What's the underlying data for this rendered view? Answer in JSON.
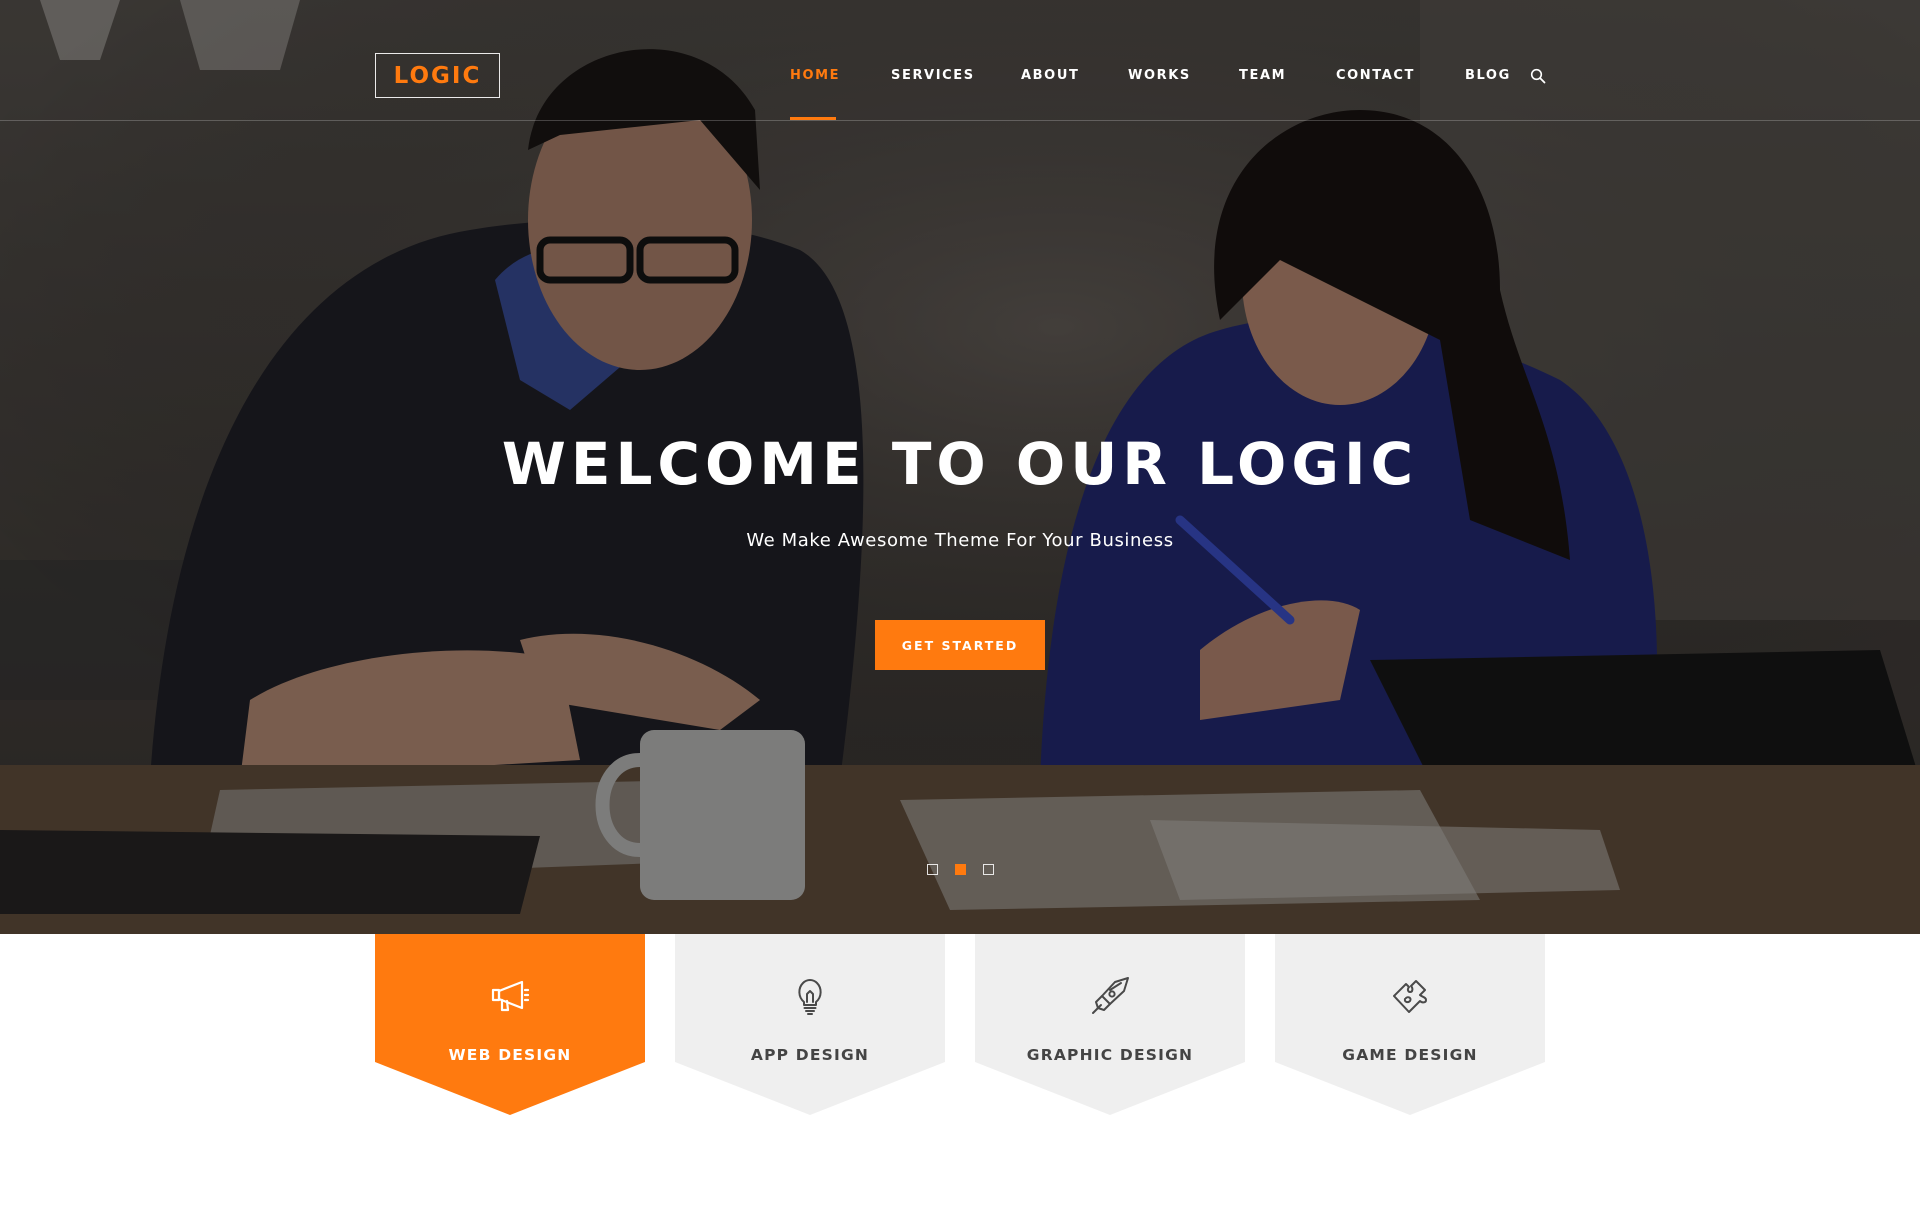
{
  "brand": {
    "logo_text": "LOGIC",
    "accent_color": "#ff7a0f"
  },
  "nav": {
    "items": [
      {
        "label": "HOME",
        "active": true
      },
      {
        "label": "SERVICES",
        "active": false
      },
      {
        "label": "ABOUT",
        "active": false
      },
      {
        "label": "WORKS",
        "active": false
      },
      {
        "label": "TEAM",
        "active": false
      },
      {
        "label": "CONTACT",
        "active": false
      },
      {
        "label": "BLOG",
        "active": false
      }
    ],
    "search_icon": "search-icon"
  },
  "hero": {
    "title": "WELCOME TO OUR LOGIC",
    "subtitle": "We Make Awesome Theme For Your Business",
    "cta_label": "GET STARTED",
    "slide_count": 3,
    "active_slide": 2
  },
  "services": [
    {
      "label": "WEB DESIGN",
      "icon": "megaphone-icon",
      "active": true
    },
    {
      "label": "APP DESIGN",
      "icon": "lightbulb-icon",
      "active": false
    },
    {
      "label": "GRAPHIC DESIGN",
      "icon": "pen-nib-icon",
      "active": false
    },
    {
      "label": "GAME DESIGN",
      "icon": "puzzle-icon",
      "active": false
    }
  ],
  "colors": {
    "card_inactive": "#efefef",
    "card_active": "#ff7a0f",
    "text_dark": "#444444"
  }
}
